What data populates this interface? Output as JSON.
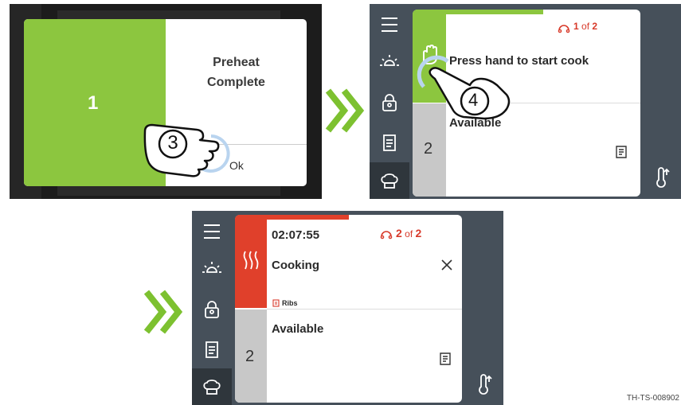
{
  "colors": {
    "green": "#8cc63f",
    "red": "#e0402b",
    "grey_panel": "#46505a",
    "grey_slot": "#c8c8c8",
    "dark": "#1c1c1c",
    "arrow_green": "#7dc130"
  },
  "panel1": {
    "slot_number": "1",
    "dialog_title": "Preheat\nComplete",
    "ok_label": "Ok",
    "step_number": "3"
  },
  "panel2": {
    "counter_current": "1",
    "counter_of": "of",
    "counter_total": "2",
    "instruction": "Press hand to start cook",
    "slot2_status": "Available",
    "slot2_number": "2",
    "step_number": "4"
  },
  "panel3": {
    "timer": "02:07:55",
    "counter_current": "2",
    "counter_of": "of",
    "counter_total": "2",
    "status": "Cooking",
    "recipe": "Ribs",
    "slot2_status": "Available",
    "slot2_number": "2",
    "progress_fraction": 0.5
  },
  "sidebar_icons": [
    "menu-icon",
    "brightness-icon",
    "lock-icon",
    "recipe-book-icon",
    "chef-hat-icon"
  ],
  "footer_code": "TH-TS-008902"
}
